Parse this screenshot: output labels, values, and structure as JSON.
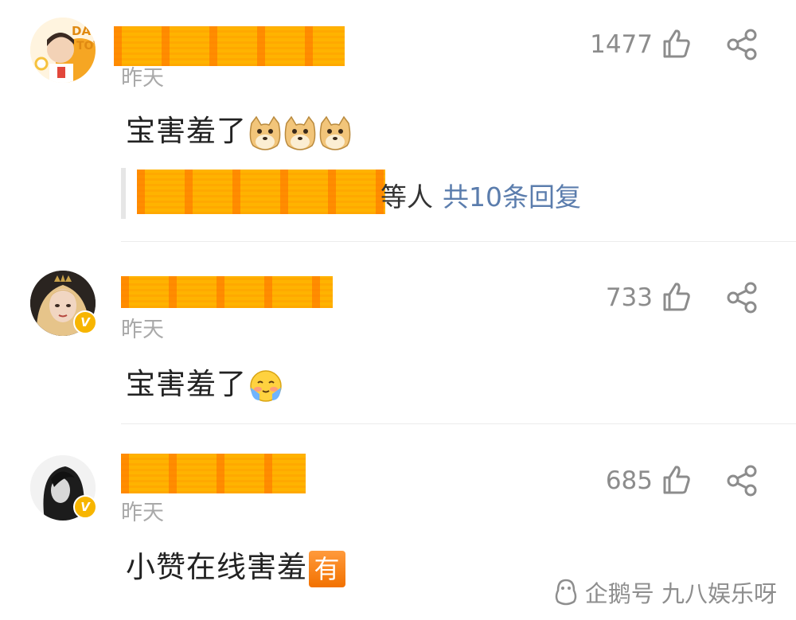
{
  "comments": [
    {
      "time": "昨天",
      "likes": "1477",
      "text": "宝害羞了",
      "emoji": [
        "doge-emoji",
        "doge-emoji",
        "doge-emoji"
      ],
      "verified": false,
      "reply_tail": "等人",
      "reply_link": "共10条回复"
    },
    {
      "time": "昨天",
      "likes": "733",
      "text": "宝害羞了",
      "emoji": [
        "shy-hug-emoji"
      ],
      "verified": true
    },
    {
      "time": "昨天",
      "likes": "685",
      "text": "小赞在线害羞",
      "tag": "有",
      "verified": true
    }
  ],
  "watermark": "企鹅号 九八娱乐呀",
  "colors": {
    "redaction": "#ffb300",
    "link": "#5b7dad",
    "badge": "#f7b500"
  }
}
